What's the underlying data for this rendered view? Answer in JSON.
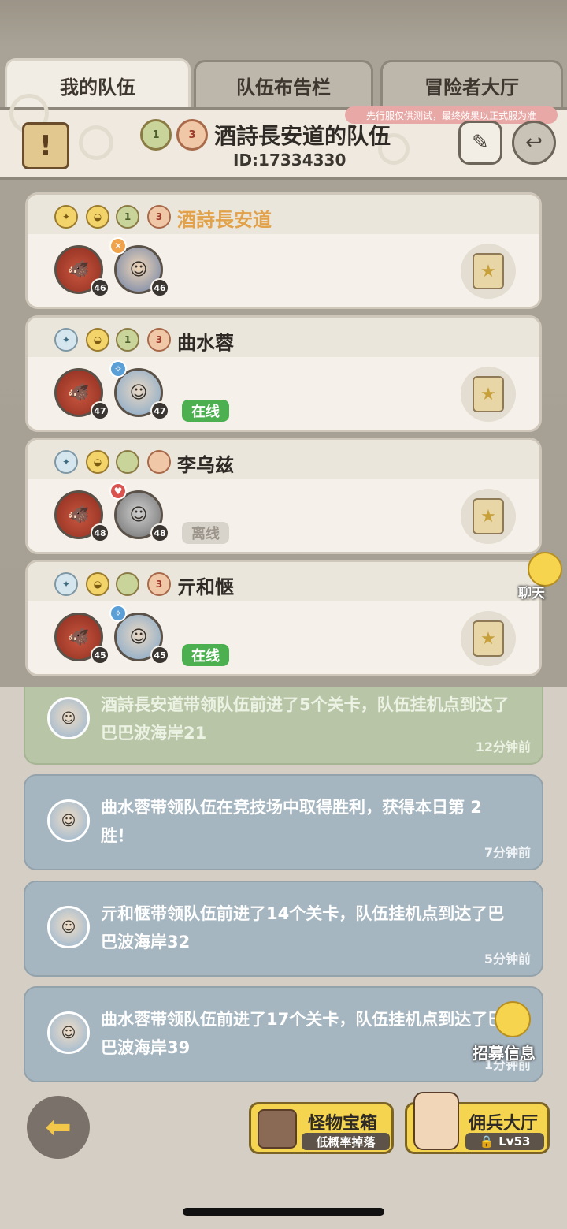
{
  "tabs": [
    {
      "label": "我的队伍",
      "active": true
    },
    {
      "label": "队伍布告栏",
      "active": false
    },
    {
      "label": "冒险者大厅",
      "active": false
    }
  ],
  "header": {
    "warn_icon": "!",
    "team_name": "酒詩長安道的队伍",
    "team_id": "ID:17334330",
    "notice": "先行服仅供测试，最终效果以正式服为准",
    "badges": [
      "1",
      "3"
    ]
  },
  "members": [
    {
      "name": "酒詩長安道",
      "leader": true,
      "pet_level": "46",
      "hero_level": "46",
      "status": "",
      "badge_nums": [
        "1",
        "3"
      ]
    },
    {
      "name": "曲水蓉",
      "leader": false,
      "pet_level": "47",
      "hero_level": "47",
      "status": "在线",
      "badge_nums": [
        "1",
        "3"
      ]
    },
    {
      "name": "李乌兹",
      "leader": false,
      "pet_level": "48",
      "hero_level": "48",
      "status": "离线",
      "badge_nums": [
        "",
        ""
      ]
    },
    {
      "name": "亓和惬",
      "leader": false,
      "pet_level": "45",
      "hero_level": "45",
      "status": "在线",
      "badge_nums": [
        "",
        "3"
      ]
    }
  ],
  "chat_label": "聊天",
  "feed": [
    {
      "text": "酒詩長安道带领队伍前进了5个关卡，队伍挂机点到达了巴巴波海岸21",
      "time": "12分钟前"
    },
    {
      "text": "曲水蓉带领队伍在竞技场中取得胜利，获得本日第 2 胜！",
      "time": "7分钟前"
    },
    {
      "text": "亓和惬带领队伍前进了14个关卡，队伍挂机点到达了巴巴波海岸32",
      "time": "5分钟前"
    },
    {
      "text": "曲水蓉带领队伍前进了17个关卡，队伍挂机点到达了巴巴波海岸39",
      "time": "1分钟前"
    }
  ],
  "recruit_label": "招募信息",
  "buttons": {
    "monster_chest": {
      "title": "怪物宝箱",
      "sub": "低概率掉落"
    },
    "mercenary_hall": {
      "title": "佣兵大厅",
      "sub": "Lv53"
    }
  },
  "colors": {
    "leader_name": "#e1a24b",
    "online": "#4caf50",
    "feed_blue": "#a6b6c1",
    "feed_green": "#b7c6a6",
    "button_yellow": "#f5d54f"
  }
}
